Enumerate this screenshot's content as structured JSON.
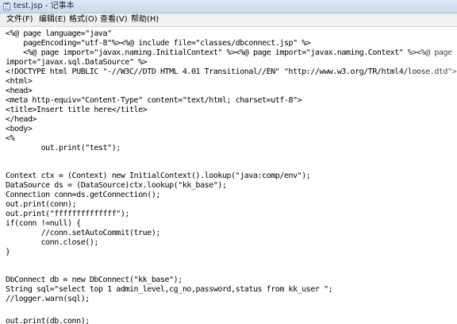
{
  "window": {
    "title": "test.jsp - 记事本",
    "icon": "notepad-icon"
  },
  "menu": [
    "文件(F)",
    "编辑(E)",
    "格式(O)",
    "查看(V)",
    "帮助(H)"
  ],
  "code_lines": [
    "<%@ page language=\"java\"",
    "    pageEncoding=\"utf-8\"%><%@ include file=\"classes/dbconnect.jsp\" %>",
    "    <%@ page import=\"javax.naming.InitialContext\" %><%@ page import=\"javax.naming.Context\" %><%@ page",
    "import=\"javax.sql.DataSource\" %>",
    "<!DOCTYPE html PUBLIC \"-//W3C//DTD HTML 4.01 Transitional//EN\" \"http://www.w3.org/TR/html4/loose.dtd\">",
    "<html>",
    "<head>",
    "<meta http-equiv=\"Content-Type\" content=\"text/html; charset=utf-8\">",
    "<title>Insert title here</title>",
    "</head>",
    "<body>",
    "<%",
    "        out.print(\"test\");",
    "",
    "Context ctx = (Context) new InitialContext().lookup(\"java:comp/env\");",
    "DataSource ds = (DataSource)ctx.lookup(\"kk_base\");",
    "Connection conn=ds.getConnection();",
    "out.print(conn);",
    "out.print(\"ffffffffffffff\");",
    "if(conn !=null) {",
    "        //conn.setAutoCommit(true);",
    "        conn.close();",
    "}",
    "",
    "DbConnect db = new DbConnect(\"kk_base\");",
    "String sql=\"select top 1 admin_level,cg_no,password,status from kk_user \";",
    "//logger.warn(sql);",
    "",
    "out.print(db.conn);"
  ]
}
